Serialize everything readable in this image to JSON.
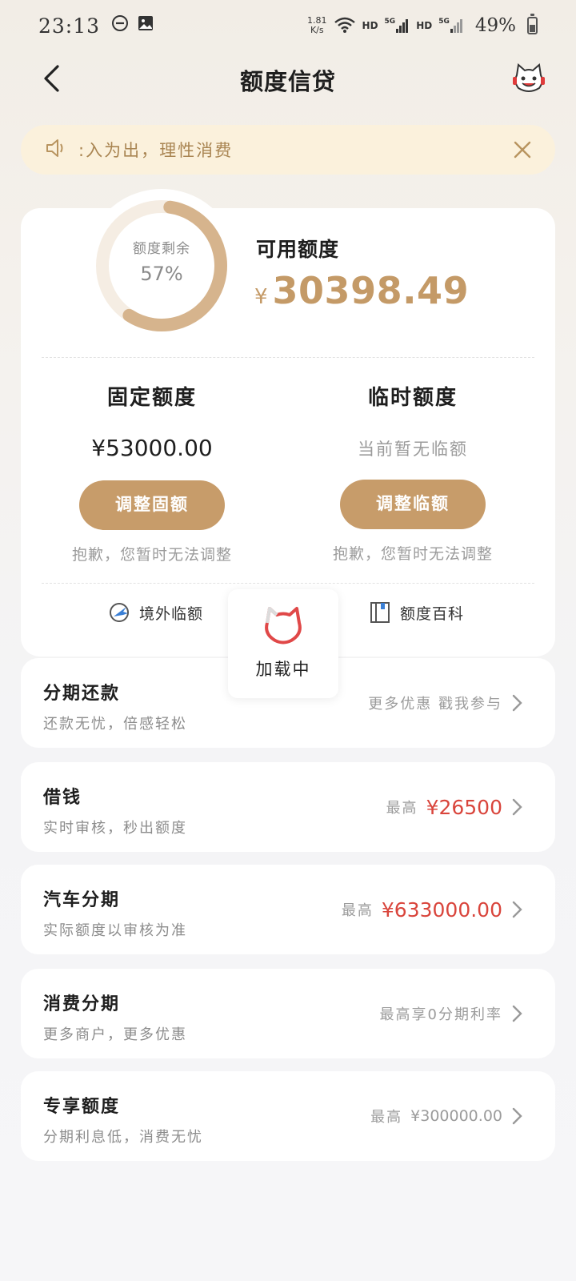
{
  "status_bar": {
    "time": "23:13",
    "net_speed_value": "1.81",
    "net_speed_unit": "K/s",
    "hd1": "HD",
    "sig1": "5G",
    "hd2": "HD",
    "sig2": "5G",
    "battery": "49%",
    "battery_level": 0.49
  },
  "header": {
    "title": "额度信贷"
  },
  "notice": {
    "text": ":入为出，理性消费"
  },
  "credit": {
    "ring_label": "额度剩余",
    "ring_percent": "57%",
    "ring_fraction": 0.57,
    "available_label": "可用额度",
    "available_currency": "¥",
    "available_value": "30398.49",
    "fixed": {
      "title": "固定额度",
      "value": "¥53000.00",
      "button": "调整固额",
      "note": "抱歉，您暂时无法调整"
    },
    "temp": {
      "title": "临时额度",
      "value": "当前暂无临额",
      "button": "调整临额",
      "note": "抱歉，您暂时无法调整"
    },
    "links": {
      "overseas": "境外临额",
      "wiki": "额度百科"
    }
  },
  "loading": {
    "text": "加载中"
  },
  "services": [
    {
      "title": "分期还款",
      "subtitle": "还款无忧，倍感轻松",
      "hint": "更多优惠 戳我参与",
      "amount": ""
    },
    {
      "title": "借钱",
      "subtitle": "实时审核，秒出额度",
      "hint": "最高",
      "amount": "¥26500"
    },
    {
      "title": "汽车分期",
      "subtitle": "实际额度以审核为准",
      "hint": "最高",
      "amount": "¥633000.00"
    },
    {
      "title": "消费分期",
      "subtitle": "更多商户，更多优惠",
      "hint": "最高享0分期利率",
      "amount": ""
    },
    {
      "title": "专享额度",
      "subtitle": "分期利息低，消费无忧",
      "hint": "最高",
      "amount": "¥300000.00"
    }
  ],
  "colors": {
    "accent": "#c79c6a",
    "amount_red": "#d9453c",
    "notice_bg": "#fbf1dc"
  }
}
